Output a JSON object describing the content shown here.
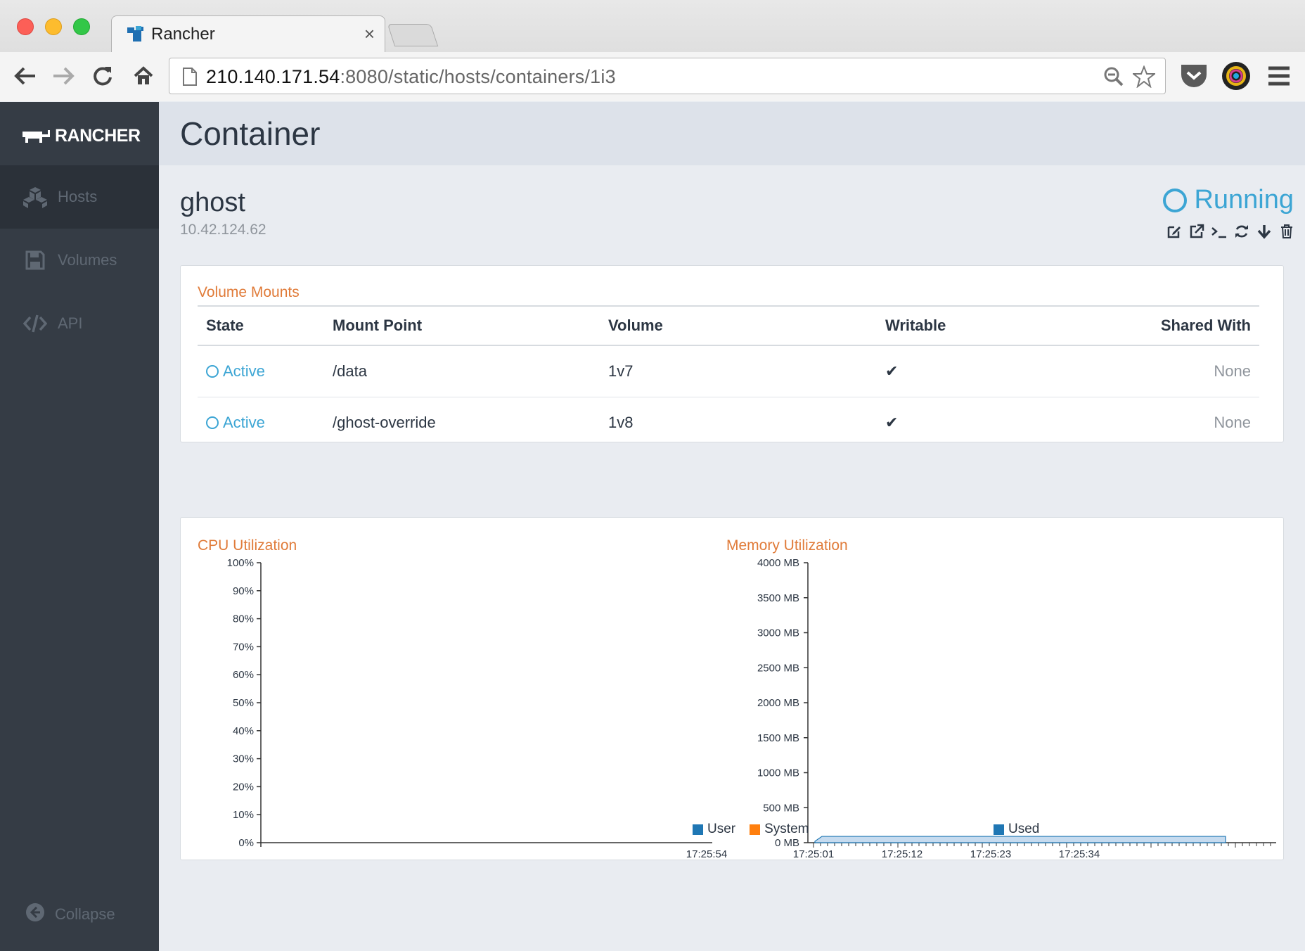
{
  "browser": {
    "tab_title": "Rancher",
    "tab_close": "×",
    "url_host": "210.140.171.54",
    "url_rest": ":8080/static/hosts/containers/1i3"
  },
  "sidebar": {
    "logo_text": "RANCHER",
    "items": [
      {
        "label": "Hosts",
        "icon": "cubes-icon",
        "active": true
      },
      {
        "label": "Volumes",
        "icon": "floppy-icon",
        "active": false
      },
      {
        "label": "API",
        "icon": "code-icon",
        "active": false
      }
    ],
    "collapse_label": "Collapse"
  },
  "page": {
    "title": "Container"
  },
  "container": {
    "name": "ghost",
    "ip": "10.42.124.62",
    "state": "Running",
    "actions": [
      "edit-icon",
      "external-link-icon",
      "terminal-icon",
      "restart-icon",
      "stop-icon",
      "delete-icon"
    ]
  },
  "volume_mounts": {
    "title": "Volume Mounts",
    "columns": [
      "State",
      "Mount Point",
      "Volume",
      "Writable",
      "Shared With"
    ],
    "rows": [
      {
        "state": "Active",
        "mount_point": "/data",
        "volume": "1v7",
        "writable": "✔",
        "shared_with": "None"
      },
      {
        "state": "Active",
        "mount_point": "/ghost-override",
        "volume": "1v8",
        "writable": "✔",
        "shared_with": "None"
      }
    ]
  },
  "colors": {
    "accent_blue": "#3ca5d4",
    "accent_orange": "#e07b39",
    "series_user": "#1f77b4",
    "series_system": "#ff7f0e",
    "series_used": "#1f77b4",
    "mem_fill": "#c6dbef"
  },
  "chart_data": [
    {
      "type": "line",
      "title": "CPU Utilization",
      "yticks": [
        "100%",
        "90%",
        "80%",
        "70%",
        "60%",
        "50%",
        "40%",
        "30%",
        "20%",
        "10%",
        "0%"
      ],
      "ylim": [
        0,
        100
      ],
      "xticks": [
        "17:25:54"
      ],
      "series": [
        {
          "name": "User",
          "values": []
        },
        {
          "name": "System",
          "values": []
        }
      ],
      "legend": "bottom"
    },
    {
      "type": "area",
      "title": "Memory Utilization",
      "yticks": [
        "4000 MB",
        "3500 MB",
        "3000 MB",
        "2500 MB",
        "2000 MB",
        "1500 MB",
        "1000 MB",
        "500 MB",
        "0 MB"
      ],
      "ylim": [
        0,
        4000
      ],
      "xticks": [
        "17:25:01",
        "17:25:12",
        "17:25:23",
        "17:25:34"
      ],
      "series": [
        {
          "name": "Used",
          "values": [
            20,
            90,
            90,
            90,
            90,
            90,
            90,
            90
          ]
        }
      ],
      "legend": "bottom"
    }
  ]
}
